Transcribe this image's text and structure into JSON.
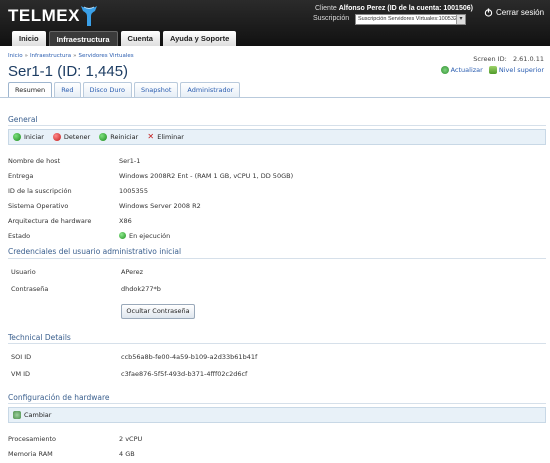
{
  "header": {
    "brand": "TELMEX",
    "client_label": "Cliente",
    "client_name": "Alfonso Perez (ID de la cuenta: 1001506)",
    "subscription_label": "Suscripción",
    "subscription_value": "Suscripción Servidores Virtuales:1005329",
    "logout_label": "Cerrar sesión"
  },
  "nav": {
    "tabs": [
      {
        "label": "Inicio"
      },
      {
        "label": "Infraestructura"
      },
      {
        "label": "Cuenta"
      },
      {
        "label": "Ayuda y Soporte"
      }
    ],
    "active": "Infraestructura"
  },
  "breadcrumb": {
    "items": [
      "Inicio",
      "Infraestructura",
      "Servidores Virtuales"
    ],
    "separator": "»"
  },
  "screen_id": "Screen ID:   2.61.0.11",
  "page_title": "Ser1-1 (ID: 1,445)",
  "actions": {
    "refresh": "Actualizar",
    "up": "Nivel superior"
  },
  "subtabs": [
    {
      "label": "Resumen"
    },
    {
      "label": "Red"
    },
    {
      "label": "Disco Duro"
    },
    {
      "label": "Snapshot"
    },
    {
      "label": "Administrador"
    }
  ],
  "general": {
    "title": "General",
    "toolbar": {
      "start": "Iniciar",
      "stop": "Detener",
      "restart": "Reiniciar",
      "delete": "Eliminar"
    },
    "rows": [
      {
        "label": "Nombre de host",
        "value": "Ser1-1"
      },
      {
        "label": "Entrega",
        "value": "Windows 2008R2 Ent - (RAM 1 GB, vCPU 1, DD 50GB)"
      },
      {
        "label": "ID de la suscripción",
        "value": "1005355"
      },
      {
        "label": "Sistema Operativo",
        "value": "Windows Server 2008 R2"
      },
      {
        "label": "Arquitectura de hardware",
        "value": "X86"
      },
      {
        "label": "Estado",
        "value": "En ejecución"
      }
    ]
  },
  "credentials": {
    "title": "Credenciales del usuario administrativo inicial",
    "user_label": "Usuario",
    "user_value": "APerez",
    "password_label": "Contraseña",
    "password_value": "dhdok277*b",
    "hide_button": "Ocultar Contraseña"
  },
  "technical": {
    "title": "Technical Details",
    "soi_label": "SOI ID",
    "soi_value": "ccb56a8b-fe00-4a59-b109-a2d33b61b41f",
    "vm_label": "VM ID",
    "vm_value": "c3fae876-5f5f-493d-b371-4fff02c2d6cf"
  },
  "hardware": {
    "title": "Configuración de hardware",
    "change_button": "Cambiar",
    "cpu_label": "Procesamiento",
    "cpu_value": "2 vCPU",
    "ram_label": "Memoria RAM",
    "ram_value": "4 GB"
  }
}
